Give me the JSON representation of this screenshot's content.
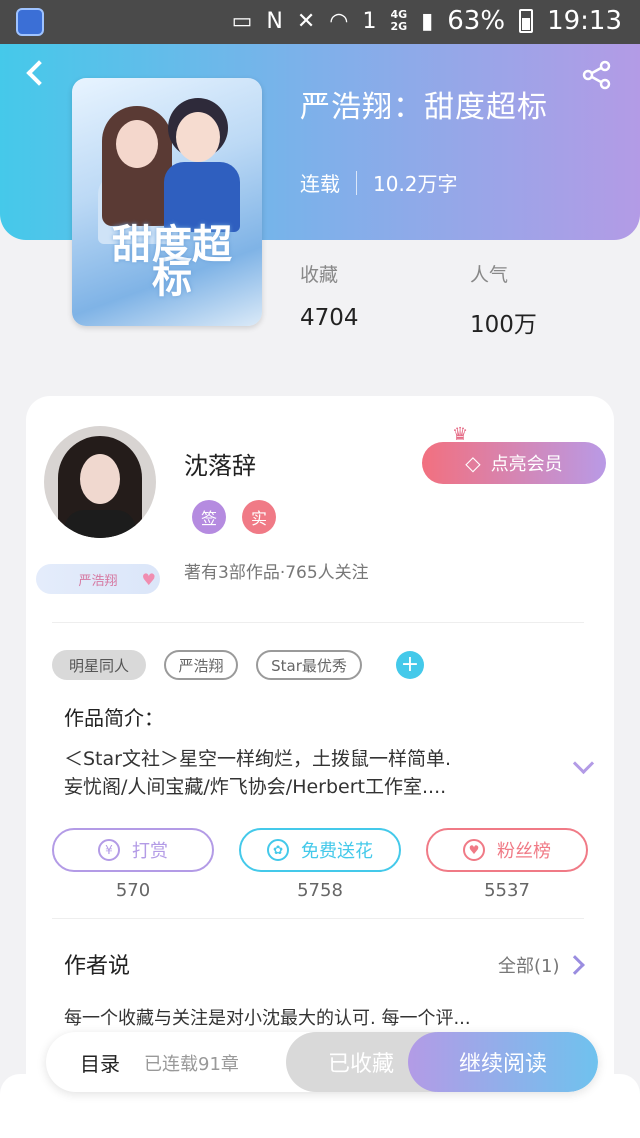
{
  "status_bar": {
    "network_small": "4G\n2G",
    "battery": "63%",
    "time": "19:13",
    "sim": "1",
    "n_label": "N"
  },
  "book": {
    "title": "严浩翔：甜度超标",
    "status": "连载",
    "word_count": "10.2万字",
    "cover_text": "甜度超标",
    "stats": [
      {
        "label": "收藏",
        "value": "4704"
      },
      {
        "label": "人气",
        "value": "100万"
      }
    ]
  },
  "author": {
    "name": "沈落辞",
    "badges": [
      {
        "text": "签",
        "color": "#b58be0"
      },
      {
        "text": "实",
        "color": "#f07a86"
      }
    ],
    "stats_text": "著有3部作品·765人关注",
    "fan_tag": "严浩翔",
    "vip_button": "点亮会员"
  },
  "tags": [
    {
      "label": "明星同人",
      "style": "solid"
    },
    {
      "label": "严浩翔",
      "style": "outline"
    },
    {
      "label": "Star最优秀",
      "style": "outline"
    }
  ],
  "intro": {
    "label": "作品简介：",
    "line1": "＜Star文社＞星空一样绚烂，土拨鼠一样简单.",
    "line2": "妄忧阁/人间宝藏/炸飞协会/Herbert工作室...."
  },
  "actions": [
    {
      "label": "打赏",
      "count": "570",
      "color": "#b39be6",
      "icon": "yen-icon",
      "glyph": "¥"
    },
    {
      "label": "免费送花",
      "count": "5758",
      "color": "#44c9ea",
      "icon": "flower-icon",
      "glyph": "✿"
    },
    {
      "label": "粉丝榜",
      "count": "5537",
      "color": "#f07a86",
      "icon": "fan-icon",
      "glyph": "♥"
    }
  ],
  "author_says": {
    "title": "作者说",
    "all_label": "全部(1)",
    "message": "每一个收藏与关注是对小沈最大的认可. 每一个评..."
  },
  "bottom_bar": {
    "toc": "目录",
    "chapter_count": "已连载91章",
    "saved": "已收藏",
    "continue": "继续阅读"
  }
}
